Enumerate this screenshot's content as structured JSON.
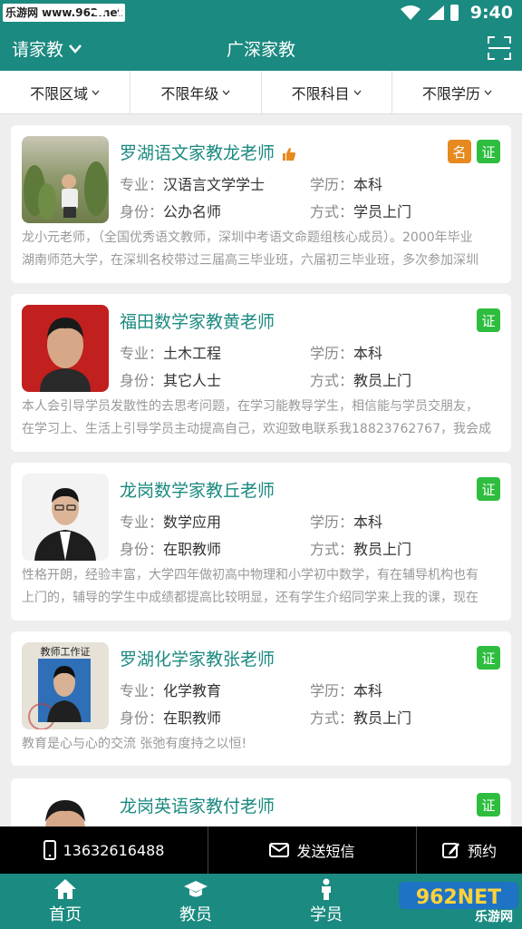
{
  "status_bar": {
    "badge": "乐游网 www.962.net",
    "time": "9:40"
  },
  "header": {
    "city": "请家教",
    "title": "广深家教"
  },
  "filters": [
    {
      "label": "不限区域"
    },
    {
      "label": "不限年级"
    },
    {
      "label": "不限科目"
    },
    {
      "label": "不限学历"
    }
  ],
  "field_labels": {
    "major": "专业：",
    "education": "学历：",
    "identity": "身份：",
    "mode": "方式："
  },
  "teachers": [
    {
      "name": "罗湖语文家教龙老师",
      "major": "汉语言文学学士",
      "education": "本科",
      "identity": "公办名师",
      "mode": "学员上门",
      "tags": [
        "名",
        "证"
      ],
      "desc": [
        "龙小元老师，（全国优秀语文教师，深圳中考语文命题组核心成员）。2000年毕业",
        "湖南师范大学，在深圳名校带过三届高三毕业班，六届初三毕业班，多次参加深圳"
      ]
    },
    {
      "name": "福田数学家教黄老师",
      "major": "土木工程",
      "education": "本科",
      "identity": "其它人士",
      "mode": "教员上门",
      "tags": [
        "证"
      ],
      "desc": [
        "本人会引导学员发散性的去思考问题，在学习能教导学生，相信能与学员交朋友，",
        "在学习上、生活上引导学员主动提高自己，欢迎致电联系我18823762767，我会成"
      ]
    },
    {
      "name": "龙岗数学家教丘老师",
      "major": "数学应用",
      "education": "本科",
      "identity": "在职教师",
      "mode": "教员上门",
      "tags": [
        "证"
      ],
      "desc": [
        "性格开朗，经验丰富，大学四年做初高中物理和小学初中数学，有在辅导机构也有",
        "上门的，辅导的学生中成绩都提高比较明显，还有学生介绍同学来上我的课，现在"
      ]
    },
    {
      "name": "罗湖化学家教张老师",
      "major": "化学教育",
      "education": "本科",
      "identity": "在职教师",
      "mode": "教员上门",
      "tags": [
        "证"
      ],
      "avatar_caption": "教师工作证",
      "desc": [
        "教育是心与心的交流 张弛有度持之以恒!"
      ]
    },
    {
      "name": "龙岗英语家教付老师",
      "tags": [
        "证"
      ]
    }
  ],
  "contact_bar": {
    "phone": "13632616488",
    "sms": "发送短信",
    "book": "预约"
  },
  "tabs": [
    {
      "label": "首页"
    },
    {
      "label": "教员"
    },
    {
      "label": "学员"
    }
  ],
  "watermark": {
    "logo": "962NET",
    "text": "乐游网"
  },
  "colors": {
    "primary": "#1b8a80",
    "tag_ming": "#e68a1f",
    "tag_zheng": "#2ebd3f"
  }
}
